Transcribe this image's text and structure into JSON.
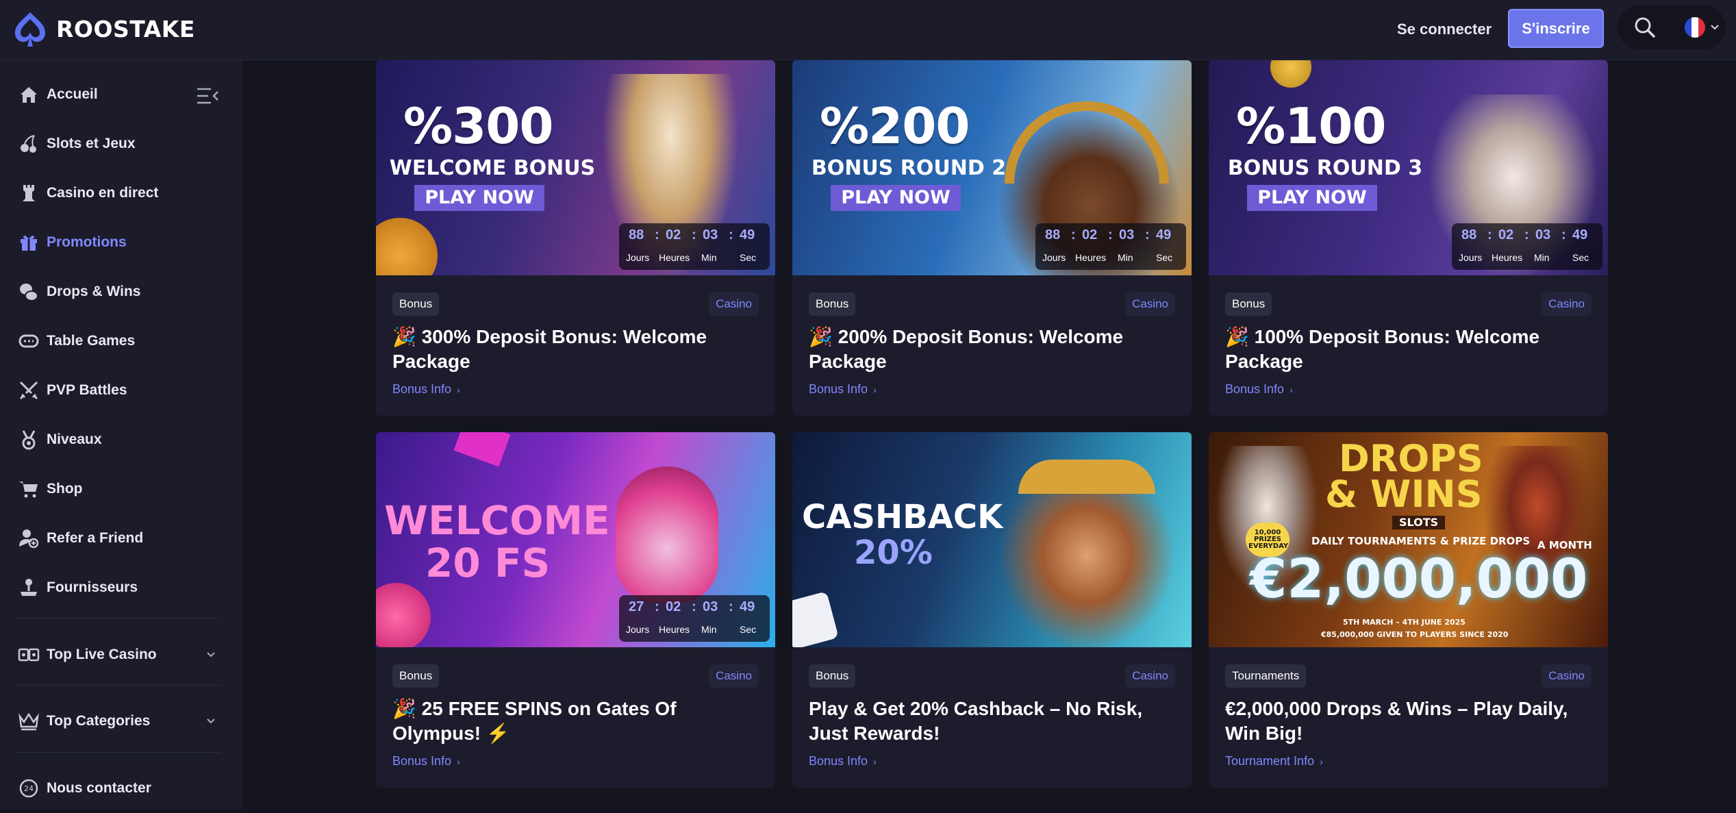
{
  "header": {
    "logo_text": "ROOSTAKE",
    "login_label": "Se connecter",
    "signup_label": "S'inscrire",
    "search_icon": "search-icon",
    "language_flag": "flag-fr-icon",
    "accent_color": "#6b74e8"
  },
  "sidebar": {
    "items": [
      {
        "label": "Accueil",
        "icon": "home-icon"
      },
      {
        "label": "Slots et Jeux",
        "icon": "cherry-icon"
      },
      {
        "label": "Casino en direct",
        "icon": "rook-icon"
      },
      {
        "label": "Promotions",
        "icon": "gift-icon",
        "active": true
      },
      {
        "label": "Drops & Wins",
        "icon": "coins-icon"
      },
      {
        "label": "Table Games",
        "icon": "poker-chip-icon"
      },
      {
        "label": "PVP Battles",
        "icon": "swords-icon"
      },
      {
        "label": "Niveaux",
        "icon": "medal-icon"
      },
      {
        "label": "Shop",
        "icon": "cart-icon"
      },
      {
        "label": "Refer a Friend",
        "icon": "user-plus-icon"
      },
      {
        "label": "Fournisseurs",
        "icon": "joystick-icon"
      }
    ],
    "sections": [
      {
        "label": "Top Live Casino",
        "icon": "cards-icon"
      },
      {
        "label": "Top Categories",
        "icon": "crown-icon"
      }
    ],
    "contact_label": "Nous contacter"
  },
  "promotions": [
    {
      "banner": {
        "headline": "%300",
        "subline": "WELCOME BONUS",
        "cta": "PLAY NOW"
      },
      "timer": {
        "days": "88",
        "hours": "02",
        "min": "03",
        "sec": "49"
      },
      "tag": "Bonus",
      "category": "Casino",
      "title": "🎉 300% Deposit Bonus: Welcome Package",
      "link": "Bonus Info"
    },
    {
      "banner": {
        "headline": "%200",
        "subline": "BONUS ROUND 2",
        "cta": "PLAY NOW"
      },
      "timer": {
        "days": "88",
        "hours": "02",
        "min": "03",
        "sec": "49"
      },
      "tag": "Bonus",
      "category": "Casino",
      "title": "🎉 200% Deposit Bonus: Welcome Package",
      "link": "Bonus Info"
    },
    {
      "banner": {
        "headline": "%100",
        "subline": "BONUS ROUND 3",
        "cta": "PLAY NOW"
      },
      "timer": {
        "days": "88",
        "hours": "02",
        "min": "03",
        "sec": "49"
      },
      "tag": "Bonus",
      "category": "Casino",
      "title": "🎉 100% Deposit Bonus: Welcome Package",
      "link": "Bonus Info"
    },
    {
      "banner": {
        "line1": "WELCOME",
        "line2": "20 FS"
      },
      "timer": {
        "days": "27",
        "hours": "02",
        "min": "03",
        "sec": "49"
      },
      "tag": "Bonus",
      "category": "Casino",
      "title": "🎉 25 FREE SPINS on Gates Of Olympus! ⚡",
      "link": "Bonus Info"
    },
    {
      "banner": {
        "line1": "CASHBACK",
        "line2": "20%"
      },
      "tag": "Bonus",
      "category": "Casino",
      "title": "Play & Get 20% Cashback – No Risk, Just Rewards!",
      "link": "Bonus Info"
    },
    {
      "banner": {
        "line1": "DROPS",
        "line2": "& WINS",
        "slots": "SLOTS",
        "tournaments": "DAILY TOURNAMENTS & PRIZE DROPS",
        "amount": "€2,000,000",
        "a_month": "A MONTH",
        "prizes": "10,000 PRIZES EVERYDAY",
        "dates": "5TH MARCH – 4TH JUNE 2025",
        "given": "€85,000,000 GIVEN TO PLAYERS SINCE 2020"
      },
      "tag": "Tournaments",
      "category": "Casino",
      "title": "€2,000,000 Drops & Wins – Play Daily, Win Big!",
      "link": "Tournament Info"
    }
  ],
  "timer_labels": {
    "days": "Jours",
    "hours": "Heures",
    "min": "Min",
    "sec": "Sec"
  }
}
